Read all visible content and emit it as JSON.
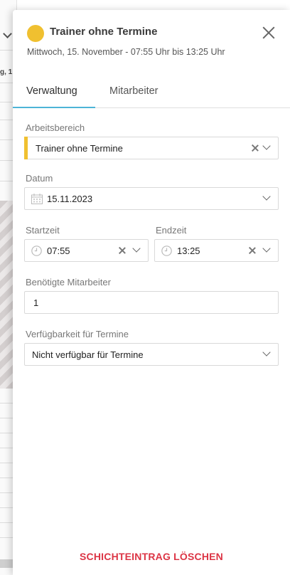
{
  "background": {
    "header_text": "g, 1"
  },
  "panel": {
    "title": "Trainer ohne Termine",
    "title_color": "#f0c030",
    "subtitle": "Mittwoch, 15. November - 07:55 Uhr bis 13:25 Uhr"
  },
  "tabs": [
    {
      "label": "Verwaltung",
      "active": true
    },
    {
      "label": "Mitarbeiter",
      "active": false
    }
  ],
  "accent_color": "#4db4d7",
  "form": {
    "arbeitsbereich": {
      "label": "Arbeitsbereich",
      "value": "Trainer ohne Termine",
      "color": "#f0c030"
    },
    "datum": {
      "label": "Datum",
      "value": "15.11.2023"
    },
    "startzeit": {
      "label": "Startzeit",
      "value": "07:55"
    },
    "endzeit": {
      "label": "Endzeit",
      "value": "13:25"
    },
    "mitarbeiter": {
      "label": "Benötigte Mitarbeiter",
      "value": "1"
    },
    "verfuegbarkeit": {
      "label": "Verfügbarkeit für Termine",
      "value": "Nicht verfügbar für Termine"
    }
  },
  "delete_label": "SCHICHTEINTRAG LÖSCHEN",
  "delete_color": "#dc3545"
}
